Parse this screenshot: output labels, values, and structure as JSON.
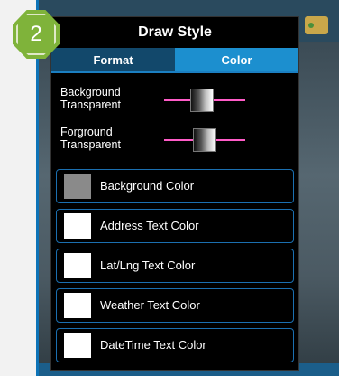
{
  "badge": {
    "number": "2"
  },
  "dialog": {
    "title": "Draw Style",
    "tabs": [
      {
        "label": "Format",
        "active": false
      },
      {
        "label": "Color",
        "active": true
      }
    ],
    "sliders": [
      {
        "label_line1": "Background",
        "label_line2": "Transparent",
        "value_fraction": 0.45
      },
      {
        "label_line1": "Forground",
        "label_line2": "Transparent",
        "value_fraction": 0.5
      }
    ],
    "color_items": [
      {
        "label": "Background Color",
        "swatch_color": "#8a8a8a"
      },
      {
        "label": "Address Text Color",
        "swatch_color": "#ffffff"
      },
      {
        "label": "Lat/Lng Text Color",
        "swatch_color": "#ffffff"
      },
      {
        "label": "Weather Text Color",
        "swatch_color": "#ffffff"
      },
      {
        "label": "DateTime Text Color",
        "swatch_color": "#ffffff"
      }
    ]
  },
  "colors": {
    "accent": "#1c8fcf",
    "slider_track": "#ff5cc8",
    "badge": "#7fb33a"
  }
}
